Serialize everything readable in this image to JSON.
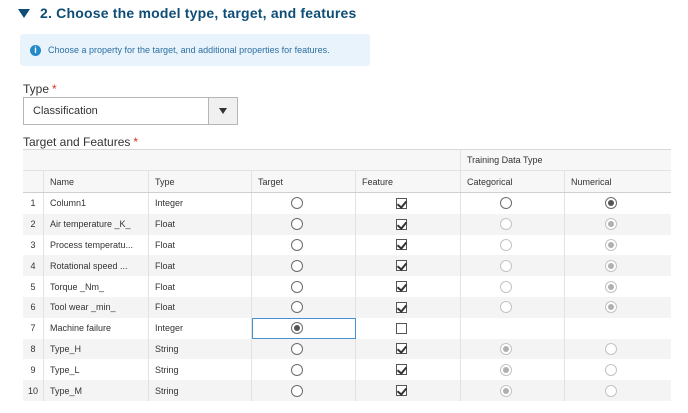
{
  "section": {
    "title": "2. Choose the model type, target, and features",
    "info": "Choose a property for the target, and additional properties for features."
  },
  "type_field": {
    "label": "Type",
    "required_marker": "*",
    "value": "Classification"
  },
  "grid": {
    "label": "Target and Features",
    "required_marker": "*",
    "group_header": "Training Data Type",
    "columns": [
      "Name",
      "Type",
      "Target",
      "Feature",
      "Categorical",
      "Numerical"
    ],
    "rows": [
      {
        "num": "1",
        "name": "Column1",
        "type": "Integer",
        "target": false,
        "feature": true,
        "training": "numerical",
        "training_enabled": true
      },
      {
        "num": "2",
        "name": "Air temperature _K_",
        "type": "Float",
        "target": false,
        "feature": true,
        "training": "numerical",
        "training_enabled": false
      },
      {
        "num": "3",
        "name": "Process temperatu...",
        "type": "Float",
        "target": false,
        "feature": true,
        "training": "numerical",
        "training_enabled": false
      },
      {
        "num": "4",
        "name": "Rotational speed ...",
        "type": "Float",
        "target": false,
        "feature": true,
        "training": "numerical",
        "training_enabled": false
      },
      {
        "num": "5",
        "name": "Torque _Nm_",
        "type": "Float",
        "target": false,
        "feature": true,
        "training": "numerical",
        "training_enabled": false
      },
      {
        "num": "6",
        "name": "Tool wear _min_",
        "type": "Float",
        "target": false,
        "feature": true,
        "training": "numerical",
        "training_enabled": false
      },
      {
        "num": "7",
        "name": "Machine failure",
        "type": "Integer",
        "target": true,
        "feature": false,
        "training": "none",
        "training_enabled": false
      },
      {
        "num": "8",
        "name": "Type_H",
        "type": "String",
        "target": false,
        "feature": true,
        "training": "categorical",
        "training_enabled": false
      },
      {
        "num": "9",
        "name": "Type_L",
        "type": "String",
        "target": false,
        "feature": true,
        "training": "categorical",
        "training_enabled": false
      },
      {
        "num": "10",
        "name": "Type_M",
        "type": "String",
        "target": false,
        "feature": true,
        "training": "categorical",
        "training_enabled": false
      }
    ]
  },
  "colors": {
    "title": "#0e4d76",
    "info_bg": "#e9f3fb",
    "info_icon": "#2389c8",
    "required": "#d93025"
  }
}
